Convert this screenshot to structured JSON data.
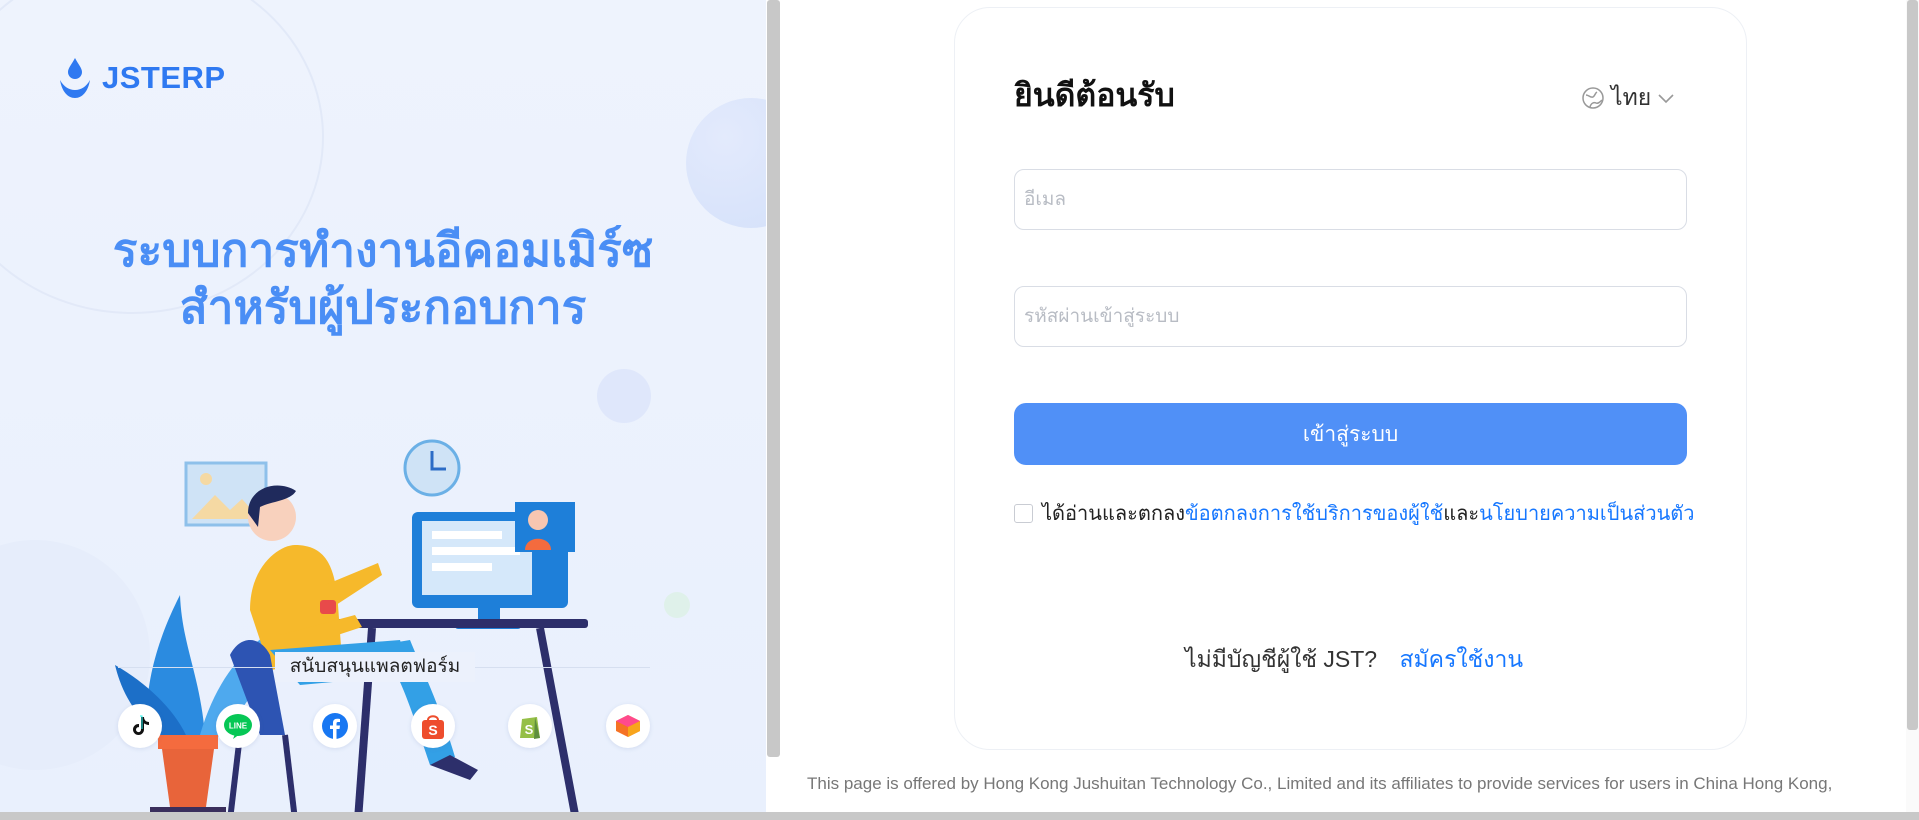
{
  "brand": {
    "name": "JSTERP",
    "accent": "#2f79f1"
  },
  "hero": {
    "headline_line1": "ระบบการทำงานอีคอมเมิร์ซ",
    "headline_line2": "สำหรับผู้ประกอบการ",
    "headline_color": "#4a8ef5"
  },
  "platforms": {
    "label": "สนับสนุนแพลตฟอร์ม",
    "items": [
      {
        "name": "tiktok-icon"
      },
      {
        "name": "line-icon"
      },
      {
        "name": "facebook-icon"
      },
      {
        "name": "shopee-icon"
      },
      {
        "name": "shopify-icon"
      },
      {
        "name": "lazada-icon"
      }
    ]
  },
  "login": {
    "title": "ยินดีต้อนรับ",
    "language": "ไทย",
    "email_placeholder": "อีเมล",
    "password_placeholder": "รหัสผ่านเข้าสู่ระบบ",
    "submit_label": "เข้าสู่ระบบ",
    "submit_color": "#5090f7",
    "agreement": {
      "prefix": "ได้อ่านและตกลง",
      "terms_link": "ข้อตกลงการใช้บริการของผู้ใช้",
      "conjunction": "และ",
      "privacy_link": "นโยบายความเป็นส่วนตัว",
      "link_color": "#1677ff"
    },
    "signup_prompt": "ไม่มีบัญชีผู้ใช้ JST?",
    "signup_link": "สมัครใช้งาน"
  },
  "footer": {
    "text": "This page is offered by Hong Kong Jushuitan Technology Co., Limited and its affiliates to provide services for users in China Hong Kong,"
  }
}
